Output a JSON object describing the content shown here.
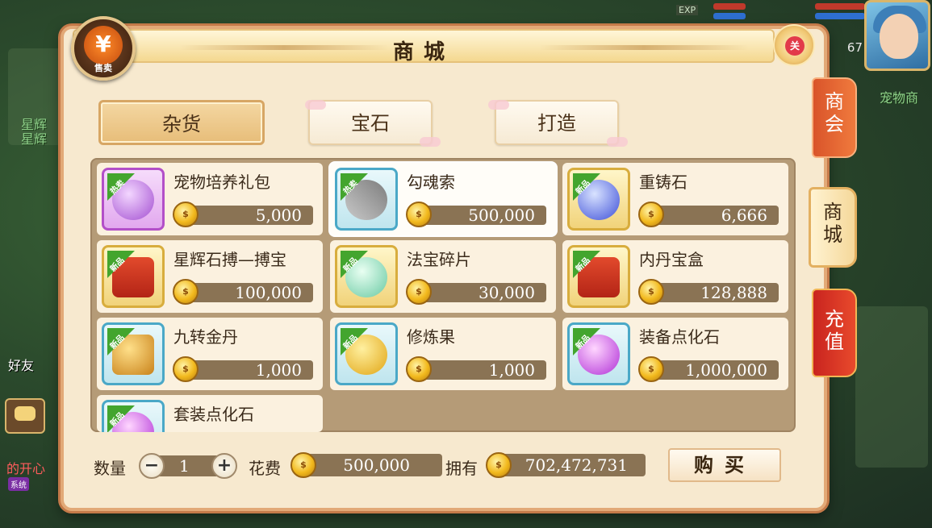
{
  "window": {
    "title": "商城"
  },
  "sell_button": {
    "glyph": "¥",
    "label": "售卖"
  },
  "close_button": {
    "label": "关"
  },
  "tabs": [
    {
      "label": "杂货",
      "active": true
    },
    {
      "label": "宝石",
      "active": false
    },
    {
      "label": "打造",
      "active": false
    }
  ],
  "side_tabs": [
    {
      "label": "商会",
      "style": "orange"
    },
    {
      "label": "商城",
      "style": "active"
    },
    {
      "label": "充值",
      "style": "red"
    }
  ],
  "items": [
    {
      "name": "宠物培养礼包",
      "price": "5,000",
      "badge": "热卖",
      "frame": "purple",
      "icon": "pet-gift-bag-icon",
      "selected": false
    },
    {
      "name": "勾魂索",
      "price": "500,000",
      "badge": "热卖",
      "frame": "blue",
      "icon": "crossed-swords-icon",
      "selected": true
    },
    {
      "name": "重铸石",
      "price": "6,666",
      "badge": "新品",
      "frame": "gold",
      "icon": "blue-orb-icon",
      "selected": false
    },
    {
      "name": "星辉石搏—搏宝",
      "price": "100,000",
      "badge": "新品",
      "frame": "gold",
      "icon": "gift-box-icon",
      "selected": false
    },
    {
      "name": "法宝碎片",
      "price": "30,000",
      "badge": "新品",
      "frame": "gold",
      "icon": "jade-egg-icon",
      "selected": false
    },
    {
      "name": "内丹宝盒",
      "price": "128,888",
      "badge": "新品",
      "frame": "gold",
      "icon": "gift-box-icon",
      "selected": false
    },
    {
      "name": "九转金丹",
      "price": "1,000",
      "badge": "新品",
      "frame": "blue",
      "icon": "treasure-chest-icon",
      "selected": false
    },
    {
      "name": "修炼果",
      "price": "1,000",
      "badge": "新品",
      "frame": "blue",
      "icon": "golden-fruit-icon",
      "selected": false
    },
    {
      "name": "装备点化石",
      "price": "1,000,000",
      "badge": "新品",
      "frame": "blue",
      "icon": "purple-orb-icon",
      "selected": false
    },
    {
      "name": "套装点化石",
      "price": "",
      "badge": "新品",
      "frame": "blue",
      "icon": "purple-orb-icon",
      "selected": false
    }
  ],
  "coin_glyph": "$",
  "purchase": {
    "quantity_label": "数量",
    "quantity": "1",
    "minus": "−",
    "plus": "+",
    "cost_label": "花费",
    "cost": "500,000",
    "owned_label": "拥有",
    "owned": "702,472,731",
    "buy_label": "购买"
  },
  "hud": {
    "level": "67",
    "exp_tag": "EXP",
    "pet_shop_label": "宠物商",
    "friend_label": "好友",
    "system_tag": "系统"
  },
  "colors": {
    "panel_bg": "#f7e9cf",
    "grid_bg": "#b59b77",
    "price_bar": "#8a7354",
    "badge_green": "#43a52e",
    "accent_orange": "#f07a3d"
  }
}
